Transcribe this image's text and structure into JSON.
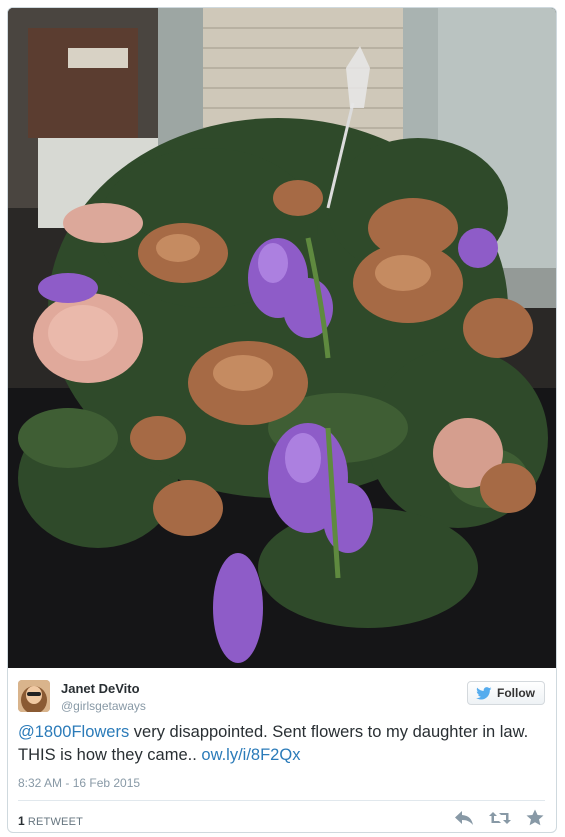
{
  "tweet": {
    "author_name": "Janet DeVito",
    "author_handle": "@girlsgetaways",
    "follow_label": "Follow",
    "mention": "@1800Flowers",
    "body": " very disappointed. Sent flowers to my daughter in law. THIS is how they came.. ",
    "link": "ow.ly/i/8F2Qx",
    "timestamp": "8:32 AM - 16 Feb 2015",
    "retweet_count": "1",
    "retweet_label": "RETWEET"
  },
  "icons": {
    "follow": "twitter-bird-icon",
    "reply": "reply-icon",
    "retweet": "retweet-icon",
    "favorite": "star-icon"
  },
  "colors": {
    "link": "#2b7bb9",
    "text": "#292f33",
    "muted": "#8899a6",
    "twitter_blue": "#55acee"
  }
}
